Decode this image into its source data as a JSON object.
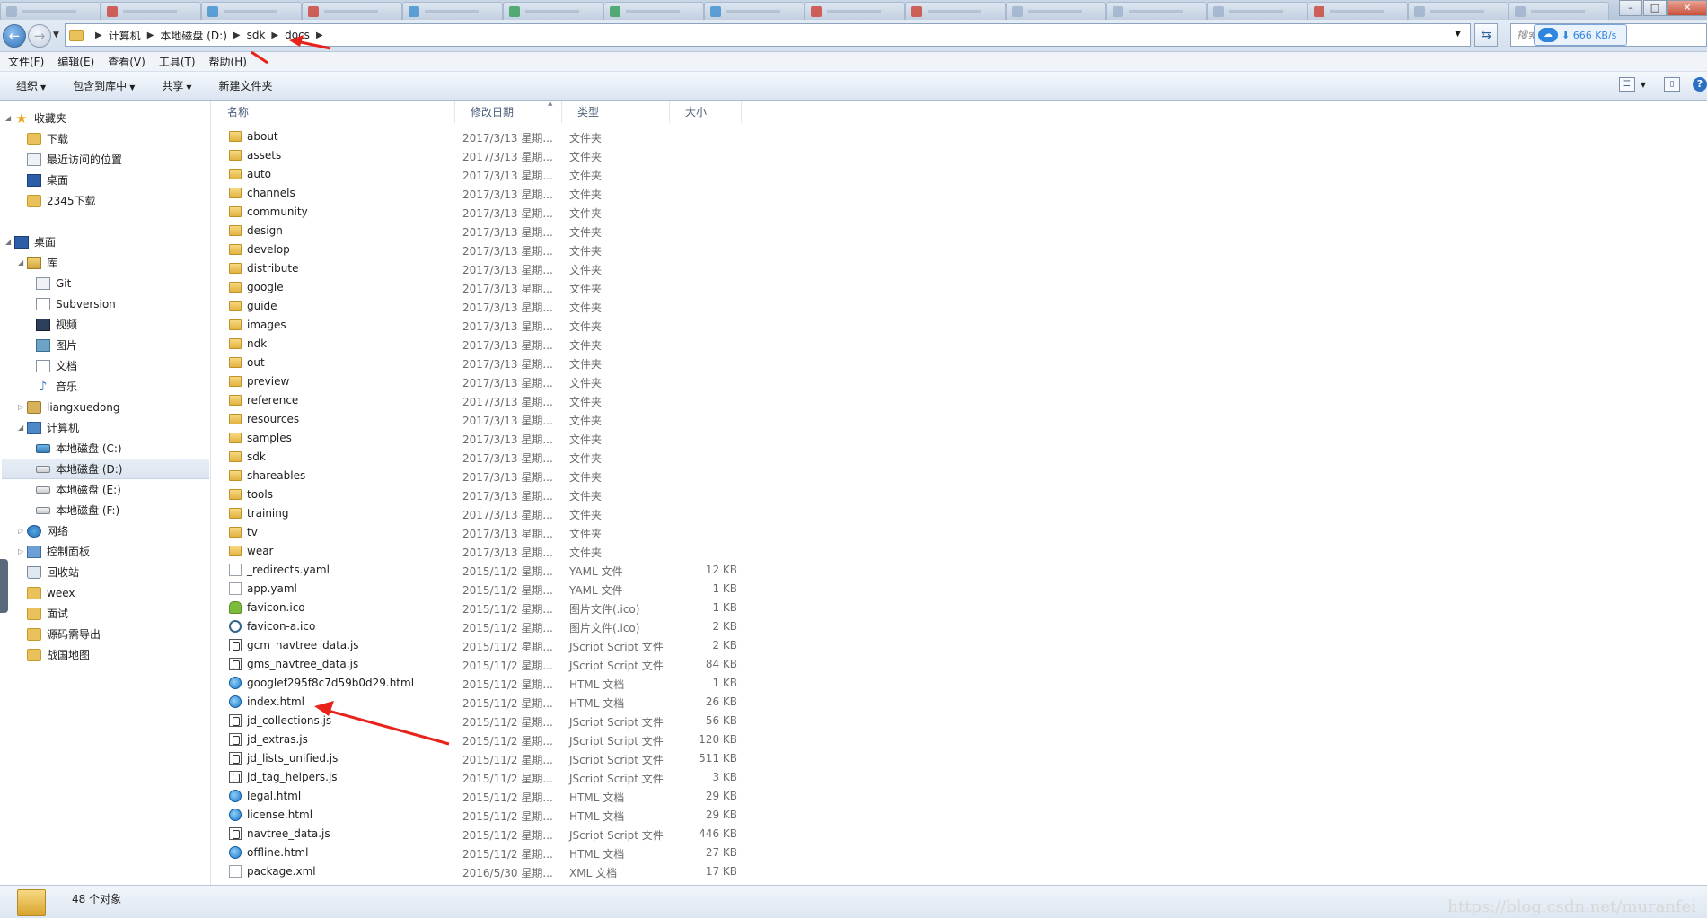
{
  "window": {
    "minimize_glyph": "–",
    "maximize_glyph": "□",
    "close_glyph": "✕"
  },
  "address": {
    "crumbs": [
      "计算机",
      "本地磁盘 (D:)",
      "sdk",
      "docs"
    ]
  },
  "search": {
    "placeholder": "搜索"
  },
  "speed_widget": {
    "text": "666 KB/s"
  },
  "menu": [
    "文件(F)",
    "编辑(E)",
    "查看(V)",
    "工具(T)",
    "帮助(H)"
  ],
  "toolbar": {
    "organize": "组织",
    "include_in_library": "包含到库中",
    "share": "共享",
    "new_folder": "新建文件夹"
  },
  "sidebar": {
    "favorites": "收藏夹",
    "fav_items": [
      "下载",
      "最近访问的位置",
      "桌面",
      "2345下载"
    ],
    "desktop": "桌面",
    "library": "库",
    "lib_items": [
      "Git",
      "Subversion",
      "视频",
      "图片",
      "文档",
      "音乐"
    ],
    "user": "liangxuedong",
    "computer": "计算机",
    "drives": [
      "本地磁盘 (C:)",
      "本地磁盘 (D:)",
      "本地磁盘 (E:)",
      "本地磁盘 (F:)"
    ],
    "network": "网络",
    "control_panel": "控制面板",
    "recycle_bin": "回收站",
    "extra_folders": [
      "weex",
      "面试",
      "源码需导出",
      "战国地图"
    ]
  },
  "columns": {
    "name": "名称",
    "date": "修改日期",
    "type": "类型",
    "size": "大小"
  },
  "files": [
    {
      "name": "about",
      "date": "2017/3/13 星期...",
      "type": "文件夹",
      "size": "",
      "icon": "folder"
    },
    {
      "name": "assets",
      "date": "2017/3/13 星期...",
      "type": "文件夹",
      "size": "",
      "icon": "folder"
    },
    {
      "name": "auto",
      "date": "2017/3/13 星期...",
      "type": "文件夹",
      "size": "",
      "icon": "folder"
    },
    {
      "name": "channels",
      "date": "2017/3/13 星期...",
      "type": "文件夹",
      "size": "",
      "icon": "folder"
    },
    {
      "name": "community",
      "date": "2017/3/13 星期...",
      "type": "文件夹",
      "size": "",
      "icon": "folder"
    },
    {
      "name": "design",
      "date": "2017/3/13 星期...",
      "type": "文件夹",
      "size": "",
      "icon": "folder"
    },
    {
      "name": "develop",
      "date": "2017/3/13 星期...",
      "type": "文件夹",
      "size": "",
      "icon": "folder"
    },
    {
      "name": "distribute",
      "date": "2017/3/13 星期...",
      "type": "文件夹",
      "size": "",
      "icon": "folder"
    },
    {
      "name": "google",
      "date": "2017/3/13 星期...",
      "type": "文件夹",
      "size": "",
      "icon": "folder"
    },
    {
      "name": "guide",
      "date": "2017/3/13 星期...",
      "type": "文件夹",
      "size": "",
      "icon": "folder"
    },
    {
      "name": "images",
      "date": "2017/3/13 星期...",
      "type": "文件夹",
      "size": "",
      "icon": "folder"
    },
    {
      "name": "ndk",
      "date": "2017/3/13 星期...",
      "type": "文件夹",
      "size": "",
      "icon": "folder"
    },
    {
      "name": "out",
      "date": "2017/3/13 星期...",
      "type": "文件夹",
      "size": "",
      "icon": "folder"
    },
    {
      "name": "preview",
      "date": "2017/3/13 星期...",
      "type": "文件夹",
      "size": "",
      "icon": "folder"
    },
    {
      "name": "reference",
      "date": "2017/3/13 星期...",
      "type": "文件夹",
      "size": "",
      "icon": "folder"
    },
    {
      "name": "resources",
      "date": "2017/3/13 星期...",
      "type": "文件夹",
      "size": "",
      "icon": "folder"
    },
    {
      "name": "samples",
      "date": "2017/3/13 星期...",
      "type": "文件夹",
      "size": "",
      "icon": "folder"
    },
    {
      "name": "sdk",
      "date": "2017/3/13 星期...",
      "type": "文件夹",
      "size": "",
      "icon": "folder"
    },
    {
      "name": "shareables",
      "date": "2017/3/13 星期...",
      "type": "文件夹",
      "size": "",
      "icon": "folder"
    },
    {
      "name": "tools",
      "date": "2017/3/13 星期...",
      "type": "文件夹",
      "size": "",
      "icon": "folder"
    },
    {
      "name": "training",
      "date": "2017/3/13 星期...",
      "type": "文件夹",
      "size": "",
      "icon": "folder"
    },
    {
      "name": "tv",
      "date": "2017/3/13 星期...",
      "type": "文件夹",
      "size": "",
      "icon": "folder"
    },
    {
      "name": "wear",
      "date": "2017/3/13 星期...",
      "type": "文件夹",
      "size": "",
      "icon": "folder"
    },
    {
      "name": "_redirects.yaml",
      "date": "2015/11/2 星期...",
      "type": "YAML 文件",
      "size": "12 KB",
      "icon": "file"
    },
    {
      "name": "app.yaml",
      "date": "2015/11/2 星期...",
      "type": "YAML 文件",
      "size": "1 KB",
      "icon": "file"
    },
    {
      "name": "favicon.ico",
      "date": "2015/11/2 星期...",
      "type": "图片文件(.ico)",
      "size": "1 KB",
      "icon": "android"
    },
    {
      "name": "favicon-a.ico",
      "date": "2015/11/2 星期...",
      "type": "图片文件(.ico)",
      "size": "2 KB",
      "icon": "ico2"
    },
    {
      "name": "gcm_navtree_data.js",
      "date": "2015/11/2 星期...",
      "type": "JScript Script 文件",
      "size": "2 KB",
      "icon": "js"
    },
    {
      "name": "gms_navtree_data.js",
      "date": "2015/11/2 星期...",
      "type": "JScript Script 文件",
      "size": "84 KB",
      "icon": "js"
    },
    {
      "name": "googlef295f8c7d59b0d29.html",
      "date": "2015/11/2 星期...",
      "type": "HTML 文档",
      "size": "1 KB",
      "icon": "html"
    },
    {
      "name": "index.html",
      "date": "2015/11/2 星期...",
      "type": "HTML 文档",
      "size": "26 KB",
      "icon": "html"
    },
    {
      "name": "jd_collections.js",
      "date": "2015/11/2 星期...",
      "type": "JScript Script 文件",
      "size": "56 KB",
      "icon": "js"
    },
    {
      "name": "jd_extras.js",
      "date": "2015/11/2 星期...",
      "type": "JScript Script 文件",
      "size": "120 KB",
      "icon": "js"
    },
    {
      "name": "jd_lists_unified.js",
      "date": "2015/11/2 星期...",
      "type": "JScript Script 文件",
      "size": "511 KB",
      "icon": "js"
    },
    {
      "name": "jd_tag_helpers.js",
      "date": "2015/11/2 星期...",
      "type": "JScript Script 文件",
      "size": "3 KB",
      "icon": "js"
    },
    {
      "name": "legal.html",
      "date": "2015/11/2 星期...",
      "type": "HTML 文档",
      "size": "29 KB",
      "icon": "html"
    },
    {
      "name": "license.html",
      "date": "2015/11/2 星期...",
      "type": "HTML 文档",
      "size": "29 KB",
      "icon": "html"
    },
    {
      "name": "navtree_data.js",
      "date": "2015/11/2 星期...",
      "type": "JScript Script 文件",
      "size": "446 KB",
      "icon": "js"
    },
    {
      "name": "offline.html",
      "date": "2015/11/2 星期...",
      "type": "HTML 文档",
      "size": "27 KB",
      "icon": "html"
    },
    {
      "name": "package.xml",
      "date": "2016/5/30 星期...",
      "type": "XML 文档",
      "size": "17 KB",
      "icon": "xml"
    }
  ],
  "status": {
    "count_text": "48 个对象"
  },
  "watermark": "https://blog.csdn.net/muranfei",
  "colors": {
    "annotation_arrow": "#e8231b",
    "selection_bg": "#dbe4ef"
  }
}
